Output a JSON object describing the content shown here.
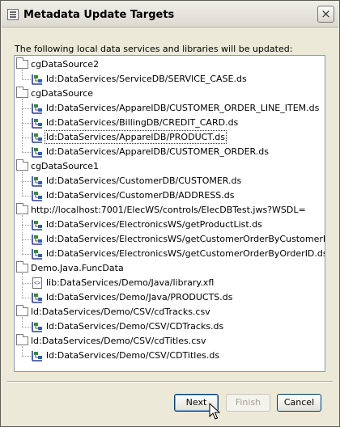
{
  "window": {
    "title": "Metadata Update Targets",
    "close_glyph": "×"
  },
  "intro_text": "The following local data services and libraries will be updated:",
  "tree": [
    {
      "label": "cgDataSource2",
      "children": [
        {
          "label": "ld:DataServices/ServiceDB/SERVICE_CASE.ds",
          "icon": "data-service-icon"
        }
      ]
    },
    {
      "label": "cgDataSource",
      "children": [
        {
          "label": "ld:DataServices/ApparelDB/CUSTOMER_ORDER_LINE_ITEM.ds",
          "icon": "data-service-icon"
        },
        {
          "label": "ld:DataServices/BillingDB/CREDIT_CARD.ds",
          "icon": "data-service-icon"
        },
        {
          "label": "ld:DataServices/ApparelDB/PRODUCT.ds",
          "icon": "data-service-icon",
          "selected": true
        },
        {
          "label": "ld:DataServices/ApparelDB/CUSTOMER_ORDER.ds",
          "icon": "data-service-icon"
        }
      ]
    },
    {
      "label": "cgDataSource1",
      "children": [
        {
          "label": "ld:DataServices/CustomerDB/CUSTOMER.ds",
          "icon": "data-service-icon"
        },
        {
          "label": "ld:DataServices/CustomerDB/ADDRESS.ds",
          "icon": "data-service-icon"
        }
      ]
    },
    {
      "label": "http://localhost:7001/ElecWS/controls/ElecDBTest.jws?WSDL=",
      "children": [
        {
          "label": "ld:DataServices/ElectronicsWS/getProductList.ds",
          "icon": "data-service-icon"
        },
        {
          "label": "ld:DataServices/ElectronicsWS/getCustomerOrderByCustomerID.ds",
          "icon": "data-service-icon"
        },
        {
          "label": "ld:DataServices/ElectronicsWS/getCustomerOrderByOrderID.ds",
          "icon": "data-service-icon"
        }
      ]
    },
    {
      "label": "Demo.Java.FuncData",
      "children": [
        {
          "label": "lib:DataServices/Demo/Java/library.xfl",
          "icon": "xfl-library-icon",
          "icon_text": "<>"
        },
        {
          "label": "ld:DataServices/Demo/Java/PRODUCTS.ds",
          "icon": "data-service-icon"
        }
      ]
    },
    {
      "label": "ld:DataServices/Demo/CSV/cdTracks.csv",
      "children": [
        {
          "label": "ld:DataServices/Demo/CSV/CDTracks.ds",
          "icon": "data-service-icon"
        }
      ]
    },
    {
      "label": "ld:DataServices/Demo/CSV/cdTitles.csv",
      "children": [
        {
          "label": "ld:DataServices/Demo/CSV/CDTitles.ds",
          "icon": "data-service-icon"
        }
      ]
    }
  ],
  "buttons": {
    "next": "Next",
    "finish": "Finish",
    "cancel": "Cancel"
  }
}
